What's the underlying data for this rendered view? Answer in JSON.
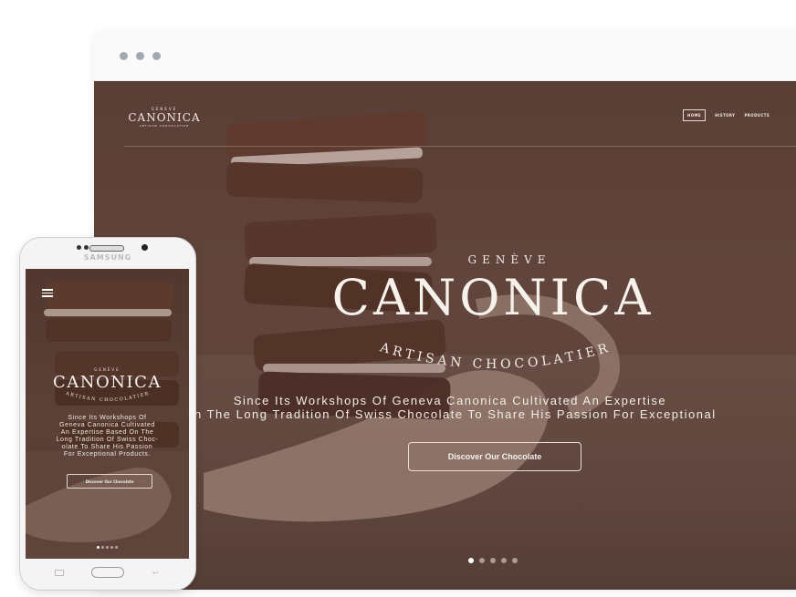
{
  "desktop": {
    "logo": {
      "top": "GENEVE",
      "main": "CANONICA",
      "sub": "ARTISAN CHOCOLATIER"
    },
    "nav": [
      "HOME",
      "HISTORY",
      "PRODUCTS"
    ],
    "hero": {
      "kicker": "GENÈVE",
      "brand": "CANONICA",
      "arc_text": "ARTISAN CHOCOLATIER",
      "tagline_1": "Since Its Workshops Of Geneva Canonica Cultivated An Expertise",
      "tagline_2": "On The Long Tradition Of Swiss Chocolate To Share His Passion For Exceptional",
      "cta": "Discover Our Chocolate"
    },
    "pager": {
      "count": 5,
      "active": 1
    }
  },
  "phone": {
    "brand_label": "SAMSUNG",
    "kicker": "GENÈVE",
    "brand": "CANONICA",
    "arc_text": "ARTISAN CHOCOLATIER",
    "tagline": [
      "Since Its Workshops Of",
      "Geneva Canonica Cultivated",
      "An Expertise Based On The",
      "Long Tradition Of Swiss Choc-",
      "olate To Share His Passion",
      "For Exceptional Products."
    ],
    "cta": "Discover Our Chocolate",
    "pager": {
      "count": 5,
      "active": 1
    }
  }
}
